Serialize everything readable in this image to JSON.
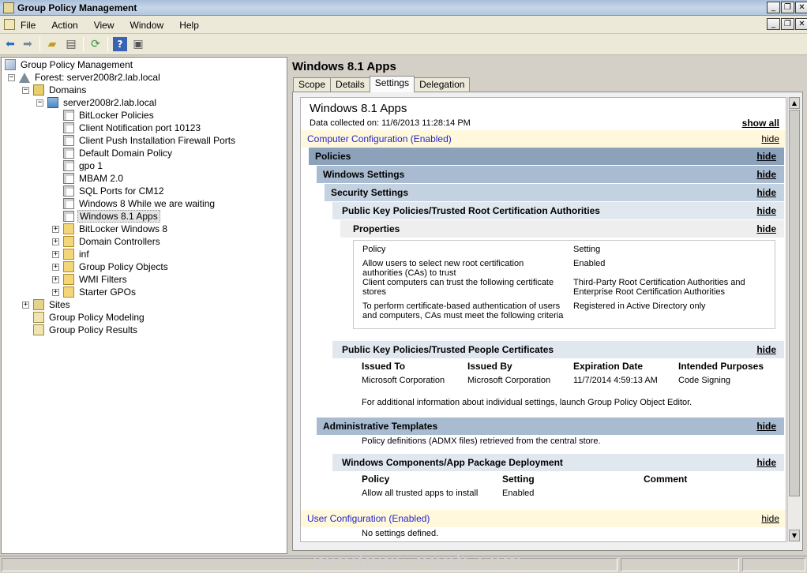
{
  "window": {
    "title": "Group Policy Management"
  },
  "menubar": {
    "items": [
      "File",
      "Action",
      "View",
      "Window",
      "Help"
    ]
  },
  "toolbar": {
    "icons": [
      "back-icon",
      "forward-icon",
      "up-folder-icon",
      "show-hide-tree-icon",
      "refresh-icon",
      "help-icon",
      "properties-icon"
    ]
  },
  "tree": {
    "root": "Group Policy Management",
    "forest": "Forest: server2008r2.lab.local",
    "domains": "Domains",
    "domain": "server2008r2.lab.local",
    "gpos": [
      "BitLocker Policies",
      "Client Notification port 10123",
      "Client Push Installation Firewall Ports",
      "Default Domain Policy",
      "gpo 1",
      "MBAM 2.0",
      "SQL Ports for CM12",
      "Windows 8 While we are waiting",
      "Windows 8.1 Apps"
    ],
    "containers": [
      "BitLocker Windows 8",
      "Domain Controllers",
      "inf",
      "Group Policy Objects",
      "WMI Filters",
      "Starter GPOs"
    ],
    "sites": "Sites",
    "modeling": "Group Policy Modeling",
    "results": "Group Policy Results"
  },
  "details": {
    "title": "Windows 8.1 Apps",
    "tabs": [
      "Scope",
      "Details",
      "Settings",
      "Delegation"
    ],
    "active_tab": "Settings"
  },
  "report": {
    "title": "Windows 8.1 Apps",
    "collected": "Data collected on: 11/6/2013 11:28:14 PM",
    "show_all": "show all",
    "hide": "hide",
    "computer_config": "Computer Configuration (Enabled)",
    "policies": "Policies",
    "windows_settings": "Windows Settings",
    "security_settings": "Security Settings",
    "pkp_root": "Public Key Policies/Trusted Root Certification Authorities",
    "properties": "Properties",
    "prop_headers": [
      "Policy",
      "Setting"
    ],
    "prop_rows": [
      {
        "policy": "Allow users to select new root certification authorities (CAs) to trust",
        "setting": "Enabled"
      },
      {
        "policy": "Client computers can trust the following certificate stores",
        "setting": "Third-Party Root Certification Authorities and Enterprise Root Certification Authorities"
      },
      {
        "policy": "To perform certificate-based authentication of users and computers, CAs must meet the following criteria",
        "setting": "Registered in Active Directory only"
      }
    ],
    "pkp_people": "Public Key Policies/Trusted People Certificates",
    "cert_headers": [
      "Issued To",
      "Issued By",
      "Expiration Date",
      "Intended Purposes"
    ],
    "cert_row": [
      "Microsoft Corporation",
      "Microsoft Corporation",
      "11/7/2014 4:59:13 AM",
      "Code Signing"
    ],
    "cert_note": "For additional information about individual settings, launch Group Policy Object Editor.",
    "admin_templates": "Administrative Templates",
    "admx_note": "Policy definitions (ADMX files) retrieved from the central store.",
    "app_pkg": "Windows Components/App Package Deployment",
    "app_headers": [
      "Policy",
      "Setting",
      "Comment"
    ],
    "app_row": [
      "Allow all trusted apps to install",
      "Enabled"
    ],
    "user_config": "User Configuration (Enabled)",
    "no_settings": "No settings defined."
  },
  "watermark": "windows-noob.com"
}
